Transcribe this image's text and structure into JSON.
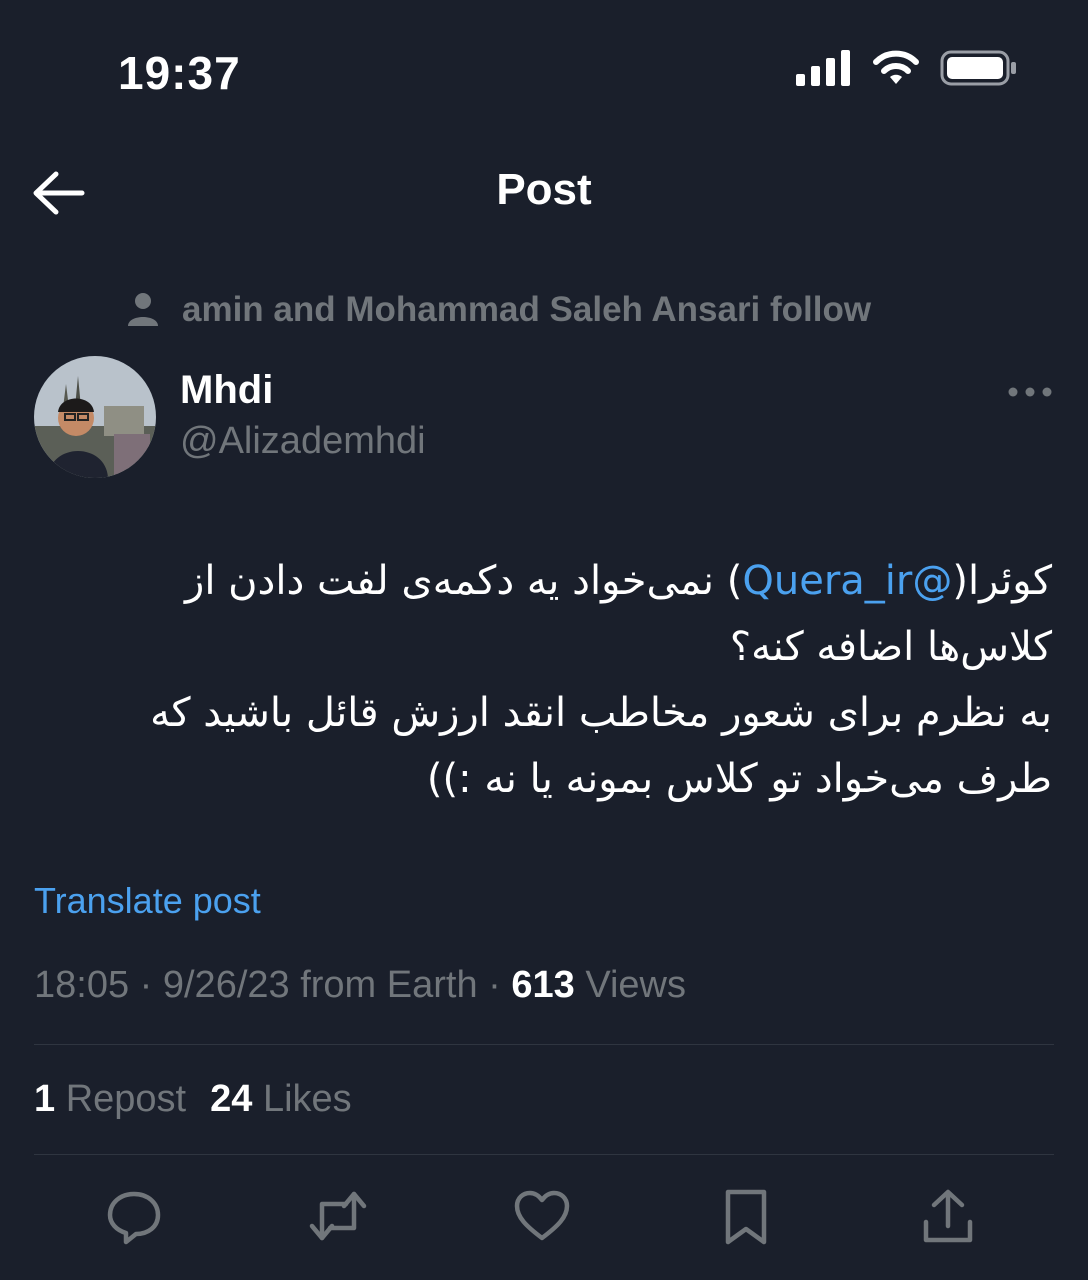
{
  "status_bar": {
    "time": "19:37",
    "icons": [
      "cellular-signal-icon",
      "wifi-icon",
      "battery-icon"
    ]
  },
  "header": {
    "back_icon": "arrow-left-icon",
    "title": "Post"
  },
  "social_context": {
    "icon": "person-icon",
    "text": "amin and Mohammad Saleh Ansari follow"
  },
  "author": {
    "name": "Mhdi",
    "handle": "@Alizademhdi",
    "more_icon": "more-horizontal-icon"
  },
  "post": {
    "segment_1": "کوئرا(",
    "mention": "@Quera_ir",
    "segment_2": ") نمی‌خواد یه دکمه‌ی لفت دادن از کلاس‌ها اضافه کنه؟",
    "line_3": "به نظرم برای شعور مخاطب انقد ارزش قائل باشید که",
    "line_4": "طرف می‌خواد تو کلاس بمونه یا نه :))"
  },
  "translate_label": "Translate post",
  "meta": {
    "timestamp": "18:05 · 9/26/23 from Earth · ",
    "views_count": "613",
    "views_label": " Views"
  },
  "stats": {
    "reposts_count": "1",
    "reposts_label": " Repost",
    "likes_count": "24",
    "likes_label": " Likes"
  },
  "actions": [
    "reply-icon",
    "repost-icon",
    "like-icon",
    "bookmark-icon",
    "share-icon"
  ],
  "colors": {
    "background": "#1a1f2b",
    "accent_link": "#4ba1ef",
    "secondary_text": "#71767b",
    "primary_text": "#ffffff"
  }
}
